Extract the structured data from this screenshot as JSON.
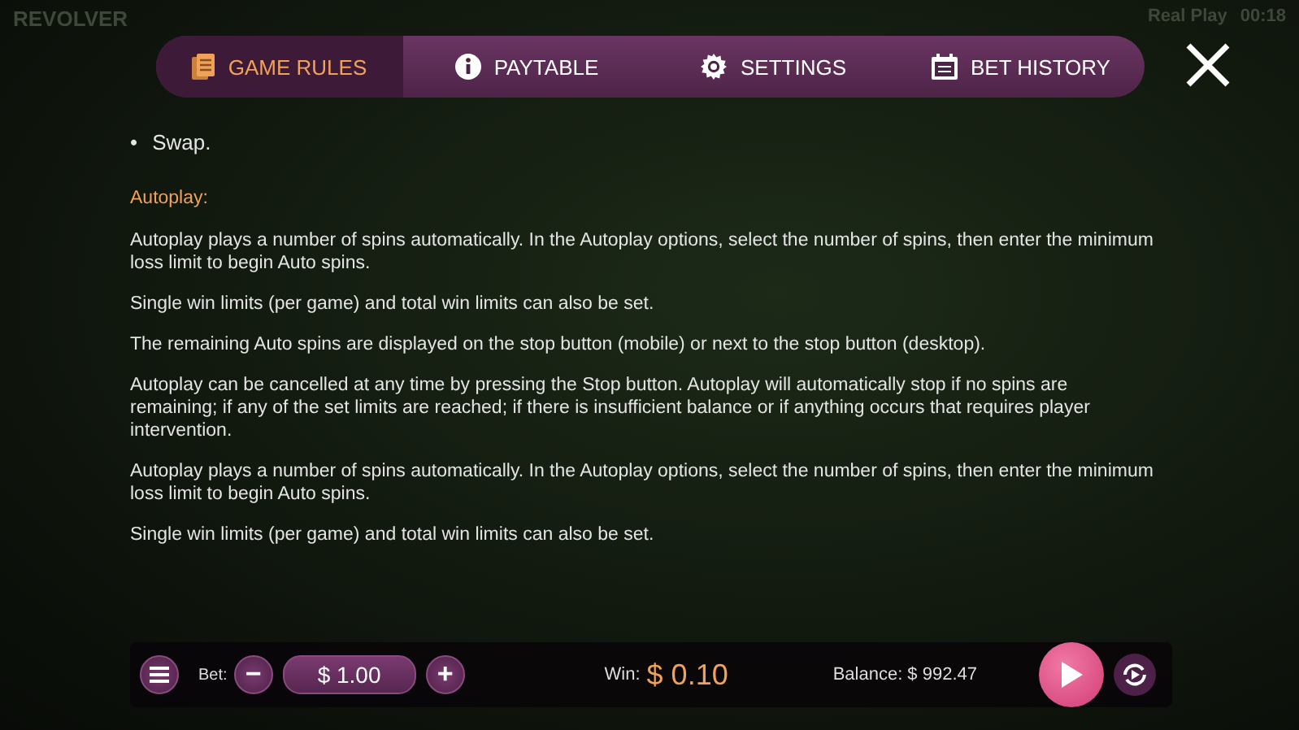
{
  "header": {
    "brand": "REVOLVER",
    "mode": "Real Play",
    "clock": "00:18"
  },
  "tabs": [
    {
      "label": "GAME RULES",
      "selected": true
    },
    {
      "label": "PAYTABLE",
      "selected": false
    },
    {
      "label": "SETTINGS",
      "selected": false
    },
    {
      "label": "BET HISTORY",
      "selected": false
    }
  ],
  "rules": {
    "bullets": [
      {
        "marker": "•",
        "text": "Swap."
      }
    ],
    "heading": "Autoplay:",
    "paragraphs": [
      "Autoplay plays a number of spins automatically. In the Autoplay options, select the number of spins, then enter the minimum loss limit to begin Auto spins.",
      "Single win limits (per game) and total win limits can also be set.",
      "The remaining Auto spins are displayed on the stop button (mobile) or next to the stop button (desktop).",
      "Autoplay can be cancelled at any time by pressing the Stop button. Autoplay will automatically stop if no spins are remaining; if any of the set limits are reached; if there is insufficient balance or if anything occurs that requires player intervention.",
      "Autoplay plays a number of spins automatically. In the Autoplay options, select the number of spins, then enter the minimum loss limit to begin Auto spins.",
      "Single win limits (per game) and total win limits can also be set."
    ]
  },
  "bottom_bar": {
    "bet_label": "Bet:",
    "bet_value": "$ 1.00",
    "minus": "−",
    "plus": "+",
    "win_label": "Win:",
    "win_value": "$ 0.10",
    "balance": "Balance: $ 992.47"
  }
}
